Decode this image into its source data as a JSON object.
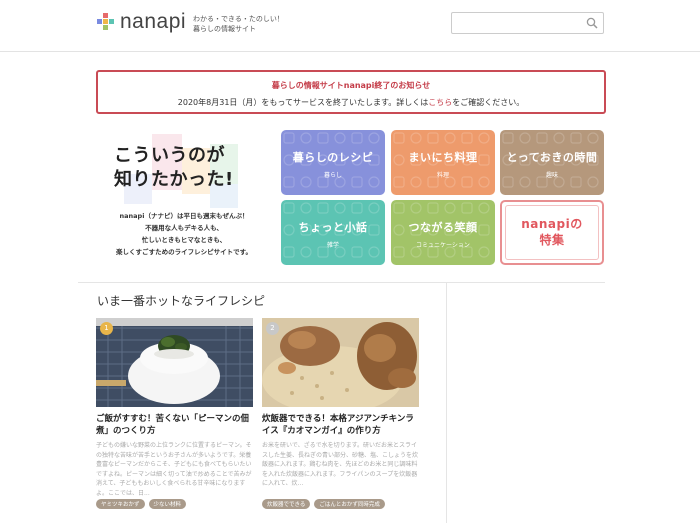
{
  "header": {
    "logo_text": "nanapi",
    "tagline_line1": "わかる・できる・たのしい！",
    "tagline_line2": "暮らしの情報サイト",
    "search_placeholder": ""
  },
  "notice": {
    "title": "暮らしの情報サイトnanapi終了のお知らせ",
    "body_before": "2020年8月31日（月）をもってサービスを終了いたします。詳しくは",
    "link": "こちら",
    "body_after": "をご確認ください。"
  },
  "hero": {
    "heading_line1": "こういうのが",
    "heading_line2": "知りたかった!",
    "desc_line1": "nanapi（ナナピ）は平日も週末もぜんぶ！",
    "desc_line2": "不器用な人もデキる人も、",
    "desc_line3": "忙しいときもヒマなときも、",
    "desc_line4": "楽しくすごすためのライフレシピサイトです。"
  },
  "categories": [
    {
      "title": "暮らしのレシピ",
      "sub": "暮らし",
      "color": "#8791db"
    },
    {
      "title": "まいにち料理",
      "sub": "料理",
      "color": "#ee9b6c"
    },
    {
      "title": "とっておきの時間",
      "sub": "趣味",
      "color": "#b5987c"
    },
    {
      "title": "ちょっと小話",
      "sub": "雑学",
      "color": "#5cc4b3"
    },
    {
      "title": "つながる笑顔",
      "sub": "コミュニケーション",
      "color": "#a2c468"
    }
  ],
  "special": {
    "line1": "nanapiの",
    "line2": "特集"
  },
  "section_title": "いま一番ホットなライフレシピ",
  "cards": [
    {
      "rank": "1",
      "title": "ご飯がすすむ！苦くない「ピーマンの佃煮」のつくり方",
      "text": "子どもの嫌いな野菜の上位ランクに位置するピーマン。その独特な苦味が苦手というお子さんが多いようです。栄養豊富なピーマンだからこそ、子どもにも食べてもらいたいですよね。ピーマンは細く切って油で炒めることで苦みが消えて、子どももおいしく食べられる甘辛味になりますよ。ここでは、日...",
      "tags": [
        "ヤミツキおかず",
        "少ない材料"
      ]
    },
    {
      "rank": "2",
      "title": "炊飯器でできる！本格アジアンチキンライス『カオマンガイ』の作り方",
      "text": "お米を研いで、ざるで水を切ります。研いだお米とスライスした生姜、長ねぎの青い部分、砂糖、塩、こしょうを炊飯器に入れます。鶏むね肉を、先ほどのお米と同じ調味料を入れた炊飯器に入れます。フライパンのスープを炊飯器に入れて、炊...",
      "tags": [
        "炊飯器でできる",
        "ごはんとおかず同時完成"
      ]
    }
  ],
  "colors": {
    "accent_red": "#c94b55",
    "rank_badge": "#e8b54a",
    "tag_bg": "#a99a8a"
  }
}
